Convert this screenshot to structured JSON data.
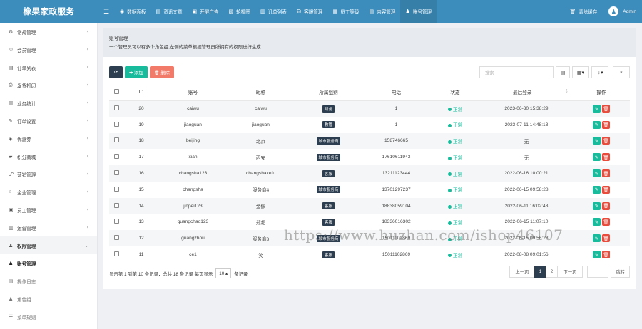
{
  "app": {
    "title": "橡果家政服务"
  },
  "topnav": [
    {
      "label": "数据面板",
      "icon": "dashboard-icon",
      "glyph": "◉"
    },
    {
      "label": "资讯文章",
      "icon": "article-icon",
      "glyph": "▤"
    },
    {
      "label": "开屏广告",
      "icon": "ad-icon",
      "glyph": "▣"
    },
    {
      "label": "轮播图",
      "icon": "image-icon",
      "glyph": "▧"
    },
    {
      "label": "订单列表",
      "icon": "order-icon",
      "glyph": "▥"
    },
    {
      "label": "客服管理",
      "icon": "headset-icon",
      "glyph": "☊"
    },
    {
      "label": "员工等级",
      "icon": "level-icon",
      "glyph": "▦"
    },
    {
      "label": "内容管理",
      "icon": "content-icon",
      "glyph": "▤"
    },
    {
      "label": "账号管理",
      "icon": "user-icon",
      "glyph": "♟",
      "active": true
    }
  ],
  "topright": {
    "clear_cache": "清除缓存",
    "user": "Admin"
  },
  "sidebar": {
    "items": [
      {
        "label": "常规管理",
        "icon": "gears-icon",
        "glyph": "⚙"
      },
      {
        "label": "会员管理",
        "icon": "member-icon",
        "glyph": "☺"
      },
      {
        "label": "订单列表",
        "icon": "order-list-icon",
        "glyph": "▤"
      },
      {
        "label": "发货打印",
        "icon": "print-icon",
        "glyph": "⎙"
      },
      {
        "label": "业务统计",
        "icon": "stats-icon",
        "glyph": "▥"
      },
      {
        "label": "订单设置",
        "icon": "wrench-icon",
        "glyph": "✎"
      },
      {
        "label": "优惠券",
        "icon": "coupon-icon",
        "glyph": "◈"
      },
      {
        "label": "积分商城",
        "icon": "mall-icon",
        "glyph": "▰"
      },
      {
        "label": "营销管理",
        "icon": "marketing-icon",
        "glyph": "☍"
      },
      {
        "label": "企业管理",
        "icon": "bank-icon",
        "glyph": "⌂"
      },
      {
        "label": "员工管理",
        "icon": "staff-icon",
        "glyph": "▣"
      },
      {
        "label": "运营管理",
        "icon": "ops-icon",
        "glyph": "▥"
      },
      {
        "label": "权限管理",
        "icon": "group-icon",
        "glyph": "♟",
        "open": true
      }
    ],
    "sub": [
      {
        "label": "账号管理",
        "icon": "user-icon",
        "glyph": "♟",
        "active": true
      },
      {
        "label": "操作日志",
        "icon": "list-icon",
        "glyph": "▤"
      },
      {
        "label": "角色组",
        "icon": "group-icon",
        "glyph": "♟"
      },
      {
        "label": "菜单规则",
        "icon": "bars-icon",
        "glyph": "☰"
      }
    ]
  },
  "panel": {
    "title": "账号管理",
    "desc": "一个管理员可以有多个角色组,左侧的菜单根据管理员所拥有的权限进行生成"
  },
  "toolbar": {
    "refresh": "⟳",
    "add": "✚ 添加",
    "delete": "🗑 删除"
  },
  "search": {
    "placeholder": "搜索"
  },
  "table": {
    "columns": [
      "ID",
      "账号",
      "昵称",
      "所属组别",
      "电话",
      "状态",
      "最后登录",
      "操作"
    ],
    "rows": [
      {
        "id": "20",
        "account": "caiwu",
        "nickname": "caiwu",
        "group": "财务",
        "phone": "1",
        "status": "正常",
        "last_login": "2023-06-30 15:38:29"
      },
      {
        "id": "19",
        "account": "jiaoguan",
        "nickname": "jiaoguan",
        "group": "教管",
        "phone": "1",
        "status": "正常",
        "last_login": "2023-07-11 14:48:13"
      },
      {
        "id": "18",
        "account": "beijing",
        "nickname": "北京",
        "group": "城市服务商",
        "phone": "158746665",
        "status": "正常",
        "last_login": "无"
      },
      {
        "id": "17",
        "account": "xian",
        "nickname": "西安",
        "group": "城市服务商",
        "phone": "17610611943",
        "status": "正常",
        "last_login": "无"
      },
      {
        "id": "16",
        "account": "changsha123",
        "nickname": "changshakefu",
        "group": "客服",
        "phone": "13211123444",
        "status": "正常",
        "last_login": "2022-06-16 10:00:21"
      },
      {
        "id": "15",
        "account": "changsha",
        "nickname": "服务商4",
        "group": "城市服务商",
        "phone": "13701297237",
        "status": "正常",
        "last_login": "2022-06-15 09:58:28"
      },
      {
        "id": "14",
        "account": "jinpei123",
        "nickname": "金佩",
        "group": "客服",
        "phone": "18838059104",
        "status": "正常",
        "last_login": "2022-06-11 16:02:43"
      },
      {
        "id": "13",
        "account": "guangchao123",
        "nickname": "郑超",
        "group": "客服",
        "phone": "18336016302",
        "status": "正常",
        "last_login": "2022-06-15 11:07:10"
      },
      {
        "id": "12",
        "account": "guangzhou",
        "nickname": "服务商3",
        "group": "城市服务商",
        "phone": "15011102869",
        "status": "正常",
        "last_login": "2022-06-15 09:56:28"
      },
      {
        "id": "11",
        "account": "ce1",
        "nickname": "笑",
        "group": "客服",
        "phone": "15011102869",
        "status": "正常",
        "last_login": "2022-08-08 09:01:56"
      }
    ]
  },
  "footer": {
    "info_prefix": "显示第 1 到第 10 条记录，总共 18 条记录 每页显示",
    "page_size": "10 ▴",
    "info_suffix": "条记录"
  },
  "pagination": {
    "prev": "上一页",
    "pages": [
      "1",
      "2"
    ],
    "next": "下一页",
    "go": "跳转"
  },
  "watermark": "https://www.huzhan.com/ishop46107"
}
